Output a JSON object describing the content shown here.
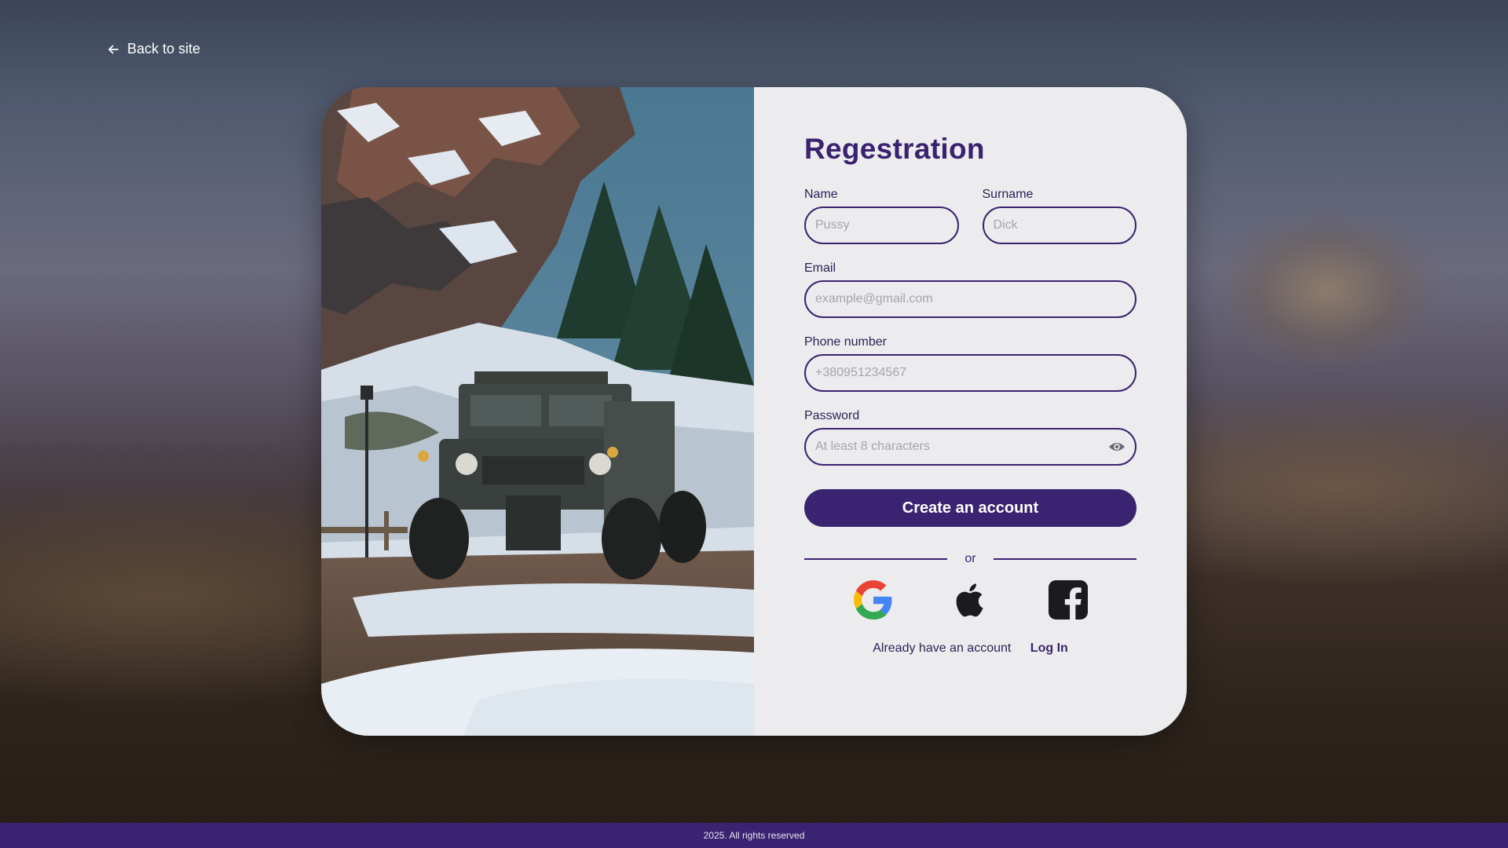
{
  "nav": {
    "back_label": "Back to site"
  },
  "form": {
    "title": "Regestration",
    "name": {
      "label": "Name",
      "placeholder": "Pussy",
      "value": ""
    },
    "surname": {
      "label": "Surname",
      "placeholder": "Dick",
      "value": ""
    },
    "email": {
      "label": "Email",
      "placeholder": "example@gmail.com",
      "value": ""
    },
    "phone": {
      "label": "Phone number",
      "placeholder": "+380951234567",
      "value": ""
    },
    "password": {
      "label": "Password",
      "placeholder": "At least 8 characters",
      "value": ""
    },
    "submit_label": "Create an account",
    "divider_label": "or",
    "social_icons": [
      "google-icon",
      "apple-icon",
      "facebook-icon"
    ],
    "login_prompt": "Already have an account",
    "login_label": "Log In"
  },
  "footer": {
    "text": "2025. All rights reserved"
  },
  "colors": {
    "accent": "#3a2370",
    "panel": "#ececee",
    "footer": "#3a2370"
  }
}
